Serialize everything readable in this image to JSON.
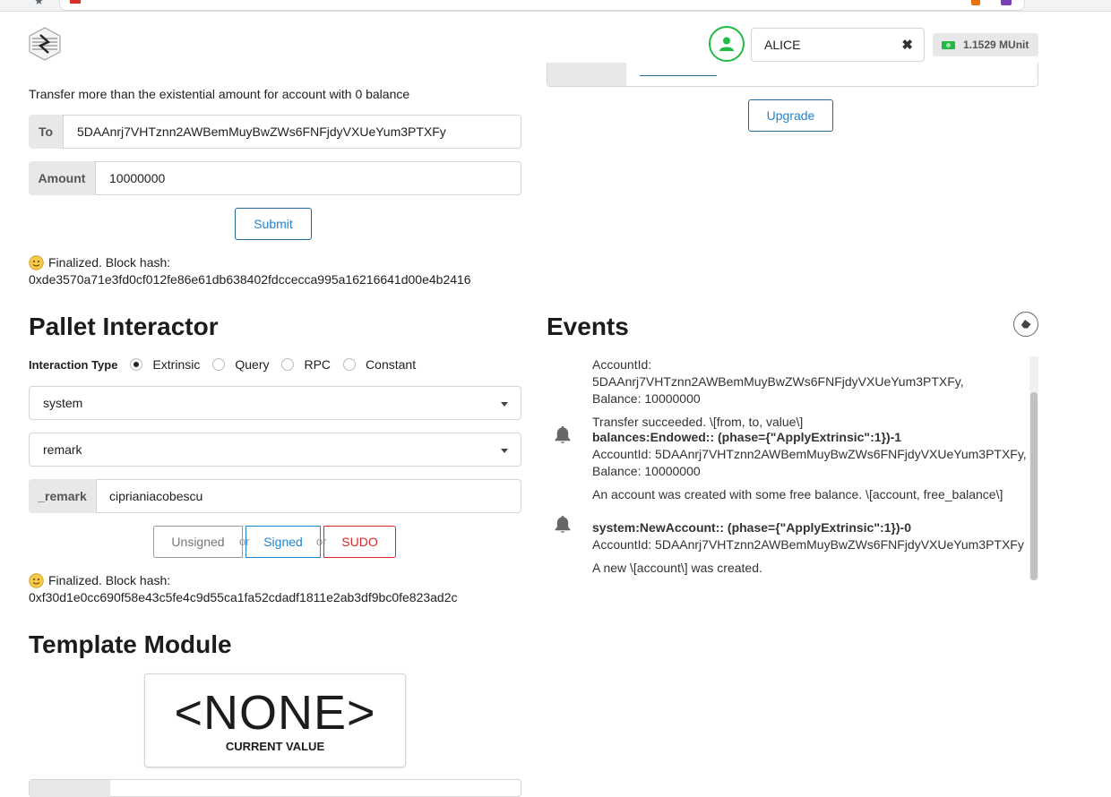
{
  "account": {
    "selected": "ALICE",
    "balance": "1.1529 MUnit"
  },
  "transfer": {
    "hint": "Transfer more than the existential amount for account with 0 balance",
    "to_label": "To",
    "to_value": "5DAAnrj7VHTznn2AWBemMuyBwZWs6FNFjdyVXUeYum3PTXFy",
    "amount_label": "Amount",
    "amount_value": "10000000",
    "submit_label": "Submit",
    "status_line1": "Finalized. Block hash:",
    "status_line2": "0xde3570a71e3fd0cf012fe86e61db638402fdccecca995a16216641d00e4b2416"
  },
  "upgrade": {
    "button_label": "Upgrade"
  },
  "pallet": {
    "title": "Pallet Interactor",
    "interaction_label": "Interaction Type",
    "types": [
      "Extrinsic",
      "Query",
      "RPC",
      "Constant"
    ],
    "selected_type": "Extrinsic",
    "pallet_value": "system",
    "callable_value": "remark",
    "param_label": "_remark",
    "param_value": "ciprianiacobescu",
    "unsigned_label": "Unsigned",
    "signed_label": "Signed",
    "sudo_label": "SUDO",
    "or_label": "or",
    "status_line1": "Finalized. Block hash:",
    "status_line2": "0xf30d1e0cc690f58e43c5fe4c9d55ca1fa52cdadf1811e2ab3df9bc0fe823ad2c"
  },
  "events": {
    "title": "Events",
    "items": [
      {
        "title": "",
        "line1": "AccountId: 5DAAnrj7VHTznn2AWBemMuyBwZWs6FNFjdyVXUeYum3PTXFy,",
        "line2": "Balance: 10000000",
        "desc": "Transfer succeeded. \\[from, to, value\\]"
      },
      {
        "title": "balances:Endowed:: (phase={\"ApplyExtrinsic\":1})-1",
        "line1": "AccountId: 5DAAnrj7VHTznn2AWBemMuyBwZWs6FNFjdyVXUeYum3PTXFy,",
        "line2": "Balance: 10000000",
        "desc": "An account was created with some free balance. \\[account, free_balance\\]"
      },
      {
        "title": "system:NewAccount:: (phase={\"ApplyExtrinsic\":1})-0",
        "line1": "AccountId: 5DAAnrj7VHTznn2AWBemMuyBwZWs6FNFjdyVXUeYum3PTXFy",
        "line2": "",
        "desc": "A new \\[account\\] was created."
      }
    ]
  },
  "template": {
    "title": "Template Module",
    "value": "<NONE>",
    "caption": "CURRENT VALUE"
  }
}
